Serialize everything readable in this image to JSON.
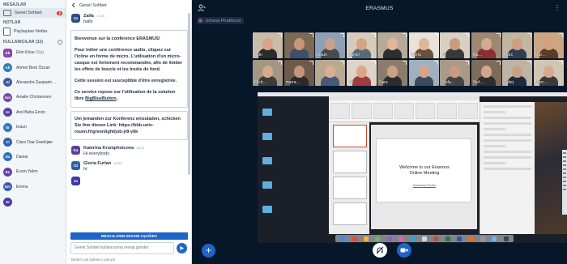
{
  "sidebar": {
    "messages_heading": "MESAJLAR",
    "public_chat": {
      "label": "Genel Sohbet",
      "badge": "2"
    },
    "notes_heading": "NOTLAR",
    "shared_notes": "Paylaşılan Notlar",
    "users_heading": "KULLANICILAR (32)",
    "users": [
      {
        "initials": "Ek",
        "name": "Ekin Köse",
        "suffix": "(Siz)",
        "color": "#8e44ad",
        "shape": "square"
      },
      {
        "initials": "Ah",
        "name": "Ahmet Berk Özcan",
        "suffix": "",
        "color": "#2c7fb8",
        "shape": "round"
      },
      {
        "initials": "Al",
        "name": "Alexandra Gasparin…",
        "suffix": "",
        "color": "#3e5a9e",
        "shape": "round"
      },
      {
        "initials": "Am",
        "name": "Amalie Christensen",
        "suffix": "",
        "color": "#7a4aa0",
        "shape": "round"
      },
      {
        "initials": "Ar",
        "name": "Arel Baha Encin",
        "suffix": "",
        "color": "#5d3fa3",
        "shape": "round"
      },
      {
        "initials": "br",
        "name": "braun",
        "suffix": "",
        "color": "#2b7bbf",
        "shape": "round"
      },
      {
        "initials": "Cl",
        "name": "Clara Daa Grønkjær",
        "suffix": "",
        "color": "#2f5fa8",
        "shape": "round"
      },
      {
        "initials": "Da",
        "name": "Danial",
        "suffix": "",
        "color": "#2e6fb3",
        "shape": "round"
      },
      {
        "initials": "Ec",
        "name": "Ecem Yalım",
        "suffix": "",
        "color": "#6a3fa0",
        "shape": "round"
      },
      {
        "initials": "Em",
        "name": "Emma",
        "suffix": "",
        "color": "#3a5ea8",
        "shape": "round"
      },
      {
        "initials": "Et",
        "name": "",
        "suffix": "",
        "color": "#4a3a9a",
        "shape": "round"
      }
    ]
  },
  "chat": {
    "back_label": "Genel Sohbet",
    "messages_top": [
      {
        "initials": "Za",
        "name": "Zalfa",
        "time": "17:28",
        "text": "hallo",
        "color": "#2d4c8c"
      }
    ],
    "welcome": {
      "p1": "Bienvenue sur la conférence ERASMUS!",
      "p2": "Pour initier une conférence audio, cliquez sur l'icône en forme de micro. L'utilisation d'un micro-casque est fortement recommandée, afin de limiter les effets de boucle et les bruits de fond.",
      "p3": "Cette session est susceptible d'être enregistrée.",
      "p4_pre": "Ce service repose sur l'utilisation de la solution libre ",
      "p4_link": "BigBlueButton",
      "p4_post": "."
    },
    "invite": "Um jemanden zur Konferenz einzuladen, schicken Sie ihm diesen Link: https://bbb.univ-rouen.fr/greenlight/job-jr8-y6k",
    "messages_bottom": [
      {
        "initials": "Ka",
        "name": "Katerina Krumpholcova",
        "time": "18:03",
        "text": "Hi everybody",
        "color": "#5b3f9e"
      },
      {
        "initials": "Gl",
        "name": "Gloria Furlan",
        "time": "18:03",
        "text": "hi",
        "color": "#2e5fa3"
      },
      {
        "initials": "Jo",
        "name": "",
        "time": "",
        "text": "",
        "color": "#3f3aa0"
      }
    ],
    "new_messages_bar": "MESAJLARIN DEVAMI AŞAĞIDA",
    "input_placeholder": "Genel Sohbet kullanıcısına mesaj gönder",
    "typing": "Birden çok kullanıcı yazıyor"
  },
  "main": {
    "title": "ERASMUS",
    "presenter": "Johana Prudiková",
    "more_icon": "⋮",
    "tiles": [
      {
        "name": "Ekin",
        "bg": "#c9bca8",
        "skin": "#d8a586",
        "shirt": "#2b2b2b"
      },
      {
        "name": "",
        "bg": "#7b6a55",
        "skin": "#c9967a",
        "shirt": "#3d4f6b"
      },
      {
        "name": "braun",
        "bg": "#8fa0b4",
        "skin": "#caa08a",
        "shirt": "#4a4a4a"
      },
      {
        "name": "Daniel",
        "bg": "#d7ccbc",
        "skin": "#d3a484",
        "shirt": "#596a7a"
      },
      {
        "name": "Al",
        "bg": "#b7aa98",
        "skin": "#e1b597",
        "shirt": "#2e2e2e"
      },
      {
        "name": "Gloria",
        "bg": "#e8e2da",
        "skin": "#e0b49a",
        "shirt": "#6b4f3a"
      },
      {
        "name": "Ja",
        "bg": "#d9cfc2",
        "skin": "#c99c80",
        "shirt": "#3a3a3a"
      },
      {
        "name": "Ma…",
        "bg": "#9c8873",
        "skin": "#d7a98f",
        "shirt": "#8a2f2f"
      },
      {
        "name": "Marc",
        "bg": "#c2b6a3",
        "skin": "#cf9f80",
        "shirt": "#2f3e52"
      },
      {
        "name": "Mar…",
        "bg": "#caa782",
        "skin": "#d2a27f",
        "shirt": "#5b3b2a"
      },
      {
        "name": "Mich…",
        "bg": "#a49683",
        "skin": "#d7aa8c",
        "shirt": "#3c3c3c"
      },
      {
        "name": "marra…",
        "bg": "#6e5a4a",
        "skin": "#c69479",
        "shirt": "#2a2a2a"
      },
      {
        "name": "",
        "bg": "#b8a990",
        "skin": "#dcae92",
        "shirt": "#47597a"
      },
      {
        "name": "Flo",
        "bg": "#ddd3c6",
        "skin": "#d9a88a",
        "shirt": "#a03c3c"
      },
      {
        "name": "Sara",
        "bg": "#8b7d6c",
        "skin": "#caa184",
        "shirt": "#2c2c2c"
      },
      {
        "name": "",
        "bg": "#9fb0c0",
        "skin": "#d4a589",
        "shirt": "#3b4a5e"
      },
      {
        "name": "Stefa…",
        "bg": "#a89a87",
        "skin": "#c99a7e",
        "shirt": "#444"
      },
      {
        "name": "Stef…",
        "bg": "#7e6c5b",
        "skin": "#d5a68a",
        "shirt": "#2e2e2e"
      },
      {
        "name": "Tadej",
        "bg": "#bfb4a4",
        "skin": "#caa086",
        "shirt": "#1f2a3a"
      },
      {
        "name": "Marc…",
        "bg": "#d1c5b3",
        "skin": "#d8ab8f",
        "shirt": "#3a3a3a"
      }
    ],
    "slide": {
      "title_line1": "Welcome to our Erasmus",
      "title_line2": "Online Meeting",
      "subtitle": "Mariacarla Pardini"
    },
    "colors": {
      "accent": "#1f64c8",
      "background": "#06172a",
      "badge": "#dd3333",
      "presenter": "#aa8fc6"
    }
  }
}
